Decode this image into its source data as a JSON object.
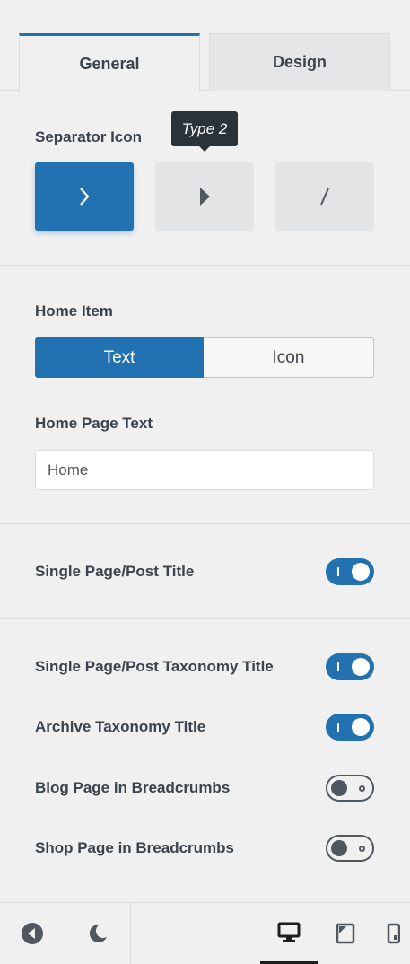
{
  "tabs": [
    {
      "label": "General",
      "active": true
    },
    {
      "label": "Design",
      "active": false
    }
  ],
  "separator": {
    "label": "Separator Icon",
    "tooltip": "Type 2",
    "options": [
      {
        "icon": "chevron-right-icon",
        "selected": true
      },
      {
        "icon": "triangle-right-icon",
        "selected": false
      },
      {
        "icon": "slash-icon",
        "selected": false
      }
    ]
  },
  "home_item": {
    "label": "Home Item",
    "options": [
      "Text",
      "Icon"
    ],
    "selected": "Text"
  },
  "home_page_text": {
    "label": "Home Page Text",
    "value": "Home"
  },
  "toggles": [
    {
      "label": "Single Page/Post Title",
      "on": true
    },
    {
      "label": "Single Page/Post Taxonomy Title",
      "on": true
    },
    {
      "label": "Archive Taxonomy Title",
      "on": true
    },
    {
      "label": "Blog Page in Breadcrumbs",
      "on": false
    },
    {
      "label": "Shop Page in Breadcrumbs",
      "on": false
    }
  ],
  "footer": {
    "icons": [
      "back-icon",
      "dark-mode-icon",
      "desktop-icon",
      "tablet-icon",
      "mobile-icon"
    ],
    "active_device": "desktop"
  },
  "colors": {
    "accent": "#2271b1",
    "background": "#f0f0f1"
  }
}
